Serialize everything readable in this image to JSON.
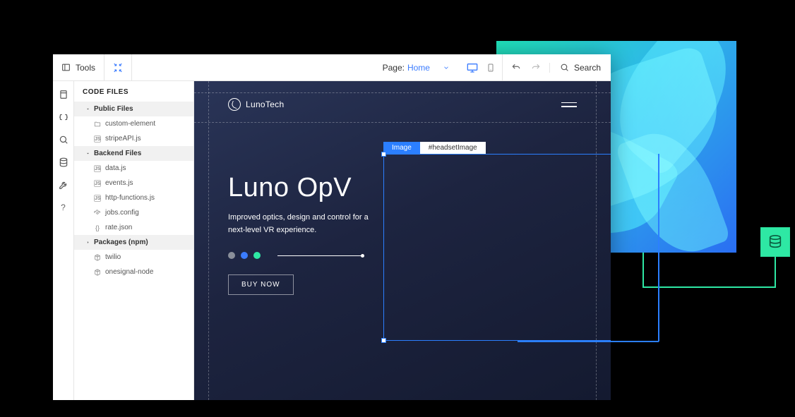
{
  "toolbar": {
    "tools_label": "Tools",
    "page_label": "Page:",
    "page_value": "Home",
    "search_label": "Search"
  },
  "sidebar": {
    "title": "CODE FILES",
    "groups": [
      {
        "label": "Public Files",
        "items": [
          {
            "label": "custom-element",
            "icon": "folder"
          },
          {
            "label": "stripeAPI.js",
            "icon": "js"
          }
        ]
      },
      {
        "label": "Backend Files",
        "items": [
          {
            "label": "data.js",
            "icon": "js"
          },
          {
            "label": "events.js",
            "icon": "js"
          },
          {
            "label": "http-functions.js",
            "icon": "js"
          },
          {
            "label": "jobs.config",
            "icon": "config"
          },
          {
            "label": "rate.json",
            "icon": "json"
          }
        ]
      },
      {
        "label": "Packages (npm)",
        "items": [
          {
            "label": "twilio",
            "icon": "pkg"
          },
          {
            "label": "onesignal-node",
            "icon": "pkg"
          }
        ]
      }
    ]
  },
  "site": {
    "brand": "LunoTech",
    "hero_title": "Luno OpV",
    "hero_sub": "Improved optics, design and control for a next-level VR experience.",
    "buy_label": "BUY NOW",
    "dots": [
      "#8a8f9a",
      "#3b7cff",
      "#2ee8a4"
    ]
  },
  "selection": {
    "type_label": "Image",
    "id_label": "#headsetImage"
  }
}
